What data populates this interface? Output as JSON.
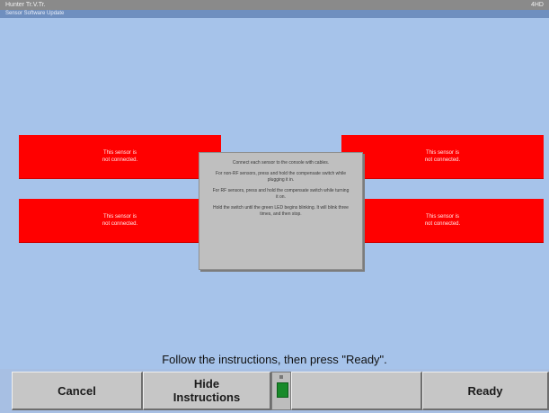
{
  "window": {
    "title": "Hunter Tr.V.Tr.",
    "title_right": "4HD",
    "subtitle": "Sensor Software Update"
  },
  "sensors": [
    {
      "label": "This sensor is\nnot connected."
    },
    {
      "label": "This sensor is\nnot connected."
    },
    {
      "label": "This sensor is\nnot connected."
    },
    {
      "label": "This sensor is\nnot connected."
    }
  ],
  "dialog": {
    "paragraphs": [
      "Connect each sensor to the console with cables.",
      "For non-RF sensors, press and hold the compensate switch while plugging it in.",
      "For RF sensors, press and hold the compensate switch while turning it on.",
      "Hold the switch until the green LED begins blinking. It will blink three times, and then stop."
    ]
  },
  "instruction": "Follow the instructions, then press \"Ready\".",
  "buttons": {
    "cancel": "Cancel",
    "hide_instructions": "Hide\nInstructions",
    "blank": "",
    "ready": "Ready"
  },
  "colors": {
    "background": "#a6c3ea",
    "sensor_error": "#ff0000",
    "led": "#188a2a"
  },
  "icons": {
    "status_led": "green-led-indicator"
  }
}
